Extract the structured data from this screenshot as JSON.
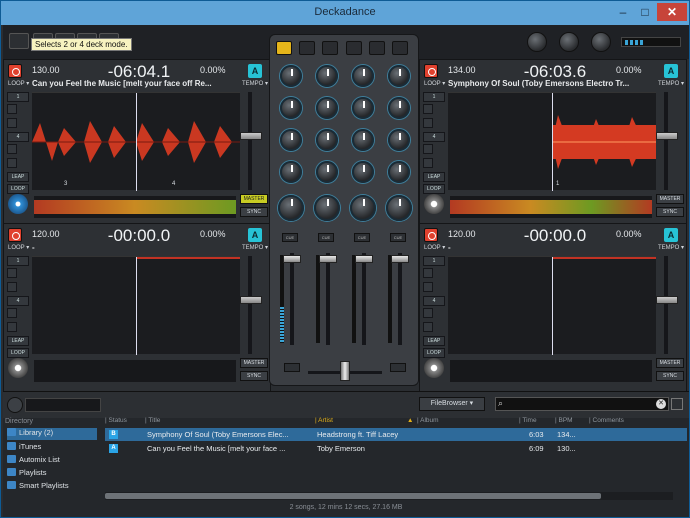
{
  "window": {
    "title": "Deckadance",
    "min": "–",
    "max": "□",
    "close": "✕"
  },
  "toolbar": {
    "tooltip": "Selects 2 or 4 deck mode."
  },
  "decks": [
    {
      "bpm": "130.00",
      "time": "-06:04.1",
      "pitch": "0.00%",
      "track": "Can you Feel the Music [melt your face off Re...",
      "loop": "LOOP ▾",
      "tempo": "TEMPO ▾",
      "beat_a": "3",
      "beat_b": "4",
      "master": "MASTER",
      "sync": "SYNC",
      "tag": "A",
      "btn_one": "1",
      "btn_four": "4",
      "btn_leap": "LEAP",
      "btn_loop": "LOOP"
    },
    {
      "bpm": "134.00",
      "time": "-06:03.6",
      "pitch": "0.00%",
      "track": "Symphony Of Soul (Toby Emersons Electro Tr...",
      "loop": "LOOP ▾",
      "tempo": "TEMPO ▾",
      "beat_a": "1",
      "beat_b": "",
      "master": "MASTER",
      "sync": "SYNC",
      "tag": "A",
      "btn_one": "1",
      "btn_four": "4",
      "btn_leap": "LEAP",
      "btn_loop": "LOOP"
    },
    {
      "bpm": "120.00",
      "time": "-00:00.0",
      "pitch": "0.00%",
      "track": "-",
      "loop": "LOOP ▾",
      "tempo": "TEMPO ▾",
      "beat_a": "",
      "beat_b": "",
      "master": "MASTER",
      "sync": "SYNC",
      "tag": "A",
      "btn_one": "1",
      "btn_four": "4",
      "btn_leap": "LEAP",
      "btn_loop": "LOOP"
    },
    {
      "bpm": "120.00",
      "time": "-00:00.0",
      "pitch": "0.00%",
      "track": "-",
      "loop": "LOOP ▾",
      "tempo": "TEMPO ▾",
      "beat_a": "",
      "beat_b": "",
      "master": "MASTER",
      "sync": "SYNC",
      "tag": "A",
      "btn_one": "1",
      "btn_four": "4",
      "btn_leap": "LEAP",
      "btn_loop": "LOOP"
    }
  ],
  "mixer": {
    "cue_labels": [
      "CUE",
      "CUE",
      "CUE",
      "CUE"
    ]
  },
  "browser": {
    "directory_header": "Directory",
    "tree": [
      "Library (2)",
      "iTunes",
      "Automix List",
      "Playlists",
      "Smart Playlists"
    ],
    "filebrowser": "FileBrowser ▾",
    "search_placeholder": "",
    "columns": {
      "status": "| Status",
      "title": "| Title",
      "artist": "| Artist",
      "sort": "▲",
      "album": "| Album",
      "time": "| Time",
      "bpm": "| BPM",
      "comments": "| Comments"
    },
    "rows": [
      {
        "badge": "B",
        "title": "Symphony Of Soul (Toby Emersons Elec...",
        "artist": "Headstrong ft. Tiff Lacey",
        "time": "6:03",
        "bpm": "134..."
      },
      {
        "badge": "A",
        "title": "Can you Feel the Music [melt your face ...",
        "artist": "Toby Emerson",
        "time": "6:09",
        "bpm": "130..."
      }
    ],
    "status": "2 songs, 12 mins 12 secs, 27.16 MB"
  },
  "colors": {
    "accent": "#2e6a9a",
    "cue_red": "#e0412e",
    "master_yellow": "#c8cc23",
    "wave_red": "#d43a22"
  }
}
